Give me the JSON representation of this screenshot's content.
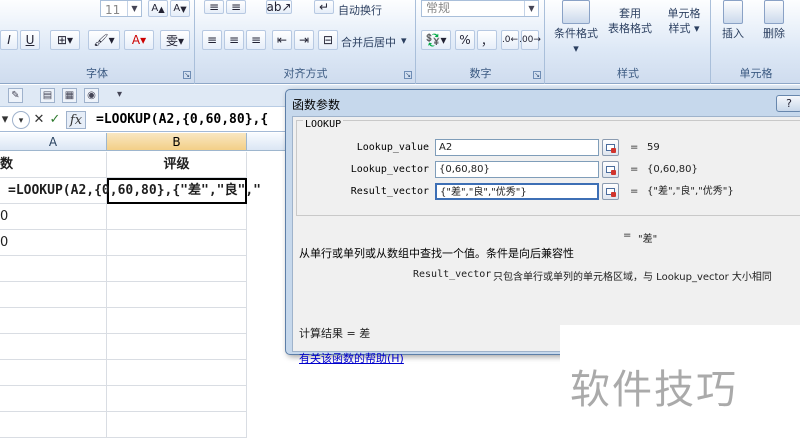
{
  "ribbon": {
    "font_size": "11",
    "wrap_text": "自动换行",
    "number_format": "常规",
    "merge_center": "合并后居中",
    "percent": "%",
    "comma": "，",
    "cond_format": "条件格式",
    "table_format_top": "套用",
    "table_format_bottom": "表格格式",
    "cell_style_top": "单元格",
    "cell_style_bottom": "样式",
    "insert": "插入",
    "delete": "删除",
    "groups": {
      "font": "字体",
      "align": "对齐方式",
      "number": "数字",
      "style": "样式",
      "cells": "单元格"
    }
  },
  "formula_bar": {
    "formula": "=LOOKUP(A2,{0,60,80},{"
  },
  "grid": {
    "col_a": "A",
    "col_b": "B",
    "b_header": "评级",
    "a_header": "数",
    "formula_cell": "=LOOKUP(A2,{0,60,80},{\"差\",\"良\",\"",
    "row2_a": "0",
    "row3_a": "0"
  },
  "dialog": {
    "title": "函数参数",
    "function_name": "LOOKUP",
    "args": [
      {
        "label": "Lookup_value",
        "input": "A2",
        "eq": "=",
        "value": "59"
      },
      {
        "label": "Lookup_vector",
        "input": "{0,60,80}",
        "eq": "=",
        "value": "{0,60,80}"
      },
      {
        "label": "Result_vector",
        "input": "{\"差\",\"良\",\"优秀\"}",
        "eq": "=",
        "value": "{\"差\",\"良\",\"优秀\"}"
      }
    ],
    "result_eq": "=",
    "result_value": "\"差\"",
    "description": "从单行或单列或从数组中查找一个值。条件是向后兼容性",
    "param_name": "Result_vector",
    "param_desc": "只包含单行或单列的单元格区域，与 Lookup_vector 大小相同",
    "calc_result": "计算结果 =  差",
    "help_link": "有关该函数的帮助(H)"
  },
  "watermark": "软件技巧"
}
